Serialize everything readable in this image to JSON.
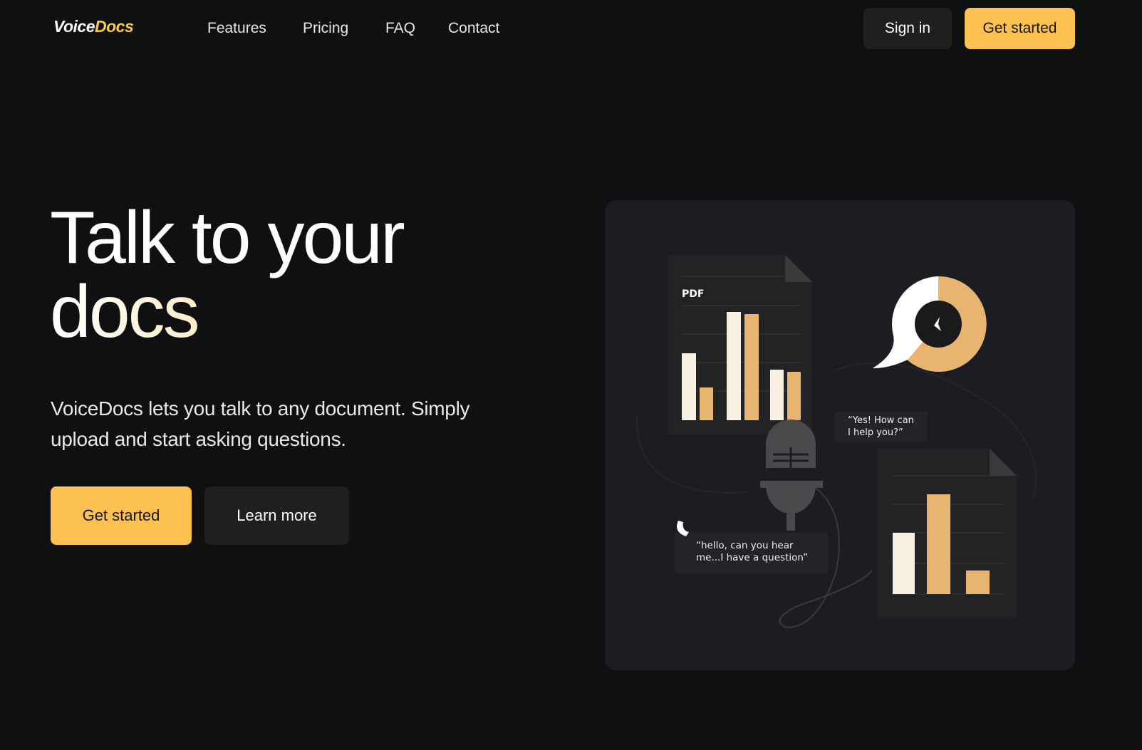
{
  "header": {
    "logo": {
      "part1": "Voice",
      "part2": "Docs"
    },
    "nav": [
      "Features",
      "Pricing",
      "FAQ",
      "Contact"
    ],
    "sign_in": "Sign in",
    "get_started": "Get started"
  },
  "hero": {
    "title_line1": "Talk to your",
    "title_line2": "docs",
    "subtitle": "VoiceDocs lets you talk to any document. Simply upload and start asking questions.",
    "primary_button": "Get started",
    "secondary_button": "Learn more"
  },
  "illustration": {
    "doc_label": "PDF",
    "reply_bubble": [
      "“Yes! How can",
      "I help you?”"
    ],
    "question_bubble": [
      "“hello, can you hear",
      "me...I have a question”"
    ]
  },
  "colors": {
    "background": "#0f1011",
    "accent": "#fcc151",
    "panel": "#1c1d22",
    "bar_cream": "#f8f1e2",
    "bar_tan": "#e8b571"
  }
}
